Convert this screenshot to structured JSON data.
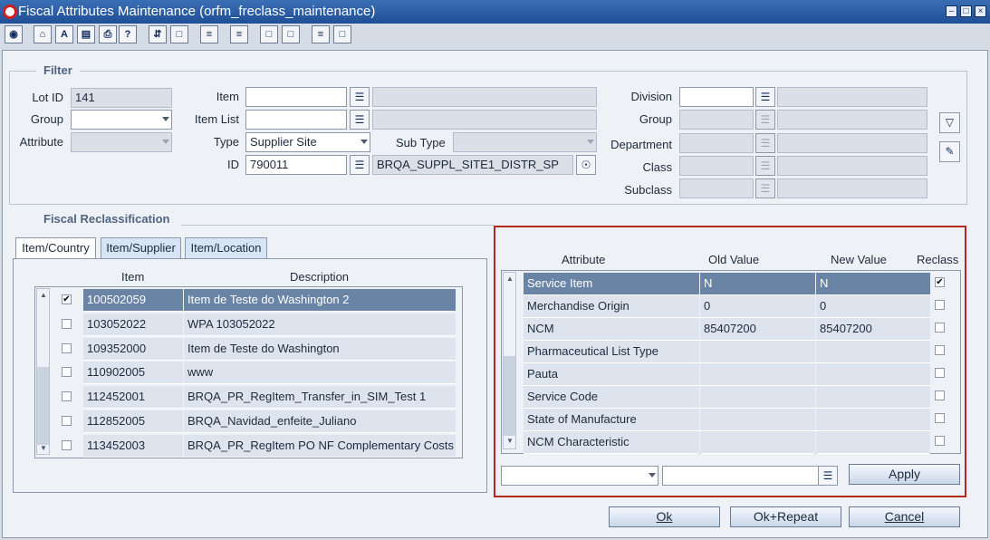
{
  "window": {
    "title": "Fiscal Attributes Maintenance  (orfm_freclass_maintenance)"
  },
  "toolbar": {
    "icons": [
      "globe-icon",
      "home-icon",
      "spellcheck-icon",
      "clipboard-icon",
      "print-icon",
      "help-icon",
      "relate-icon",
      "new-doc-icon",
      "list-icon",
      "list-alt-icon",
      "doc-icon",
      "doc-alt-icon",
      "nav-list-icon",
      "nav-doc-icon"
    ]
  },
  "filter": {
    "title": "Filter",
    "lot_id_label": "Lot ID",
    "lot_id_value": "141",
    "group_label": "Group",
    "group_value": "",
    "attribute_label": "Attribute",
    "attribute_value": "",
    "item_label": "Item",
    "item_value": "",
    "item_list_label": "Item List",
    "item_list_value": "",
    "type_label": "Type",
    "type_value": "Supplier Site",
    "sub_type_label": "Sub Type",
    "sub_type_value": "",
    "id_label": "ID",
    "id_value": "790011",
    "id_desc": "BRQA_SUPPL_SITE1_DISTR_SP",
    "division_label": "Division",
    "group2_label": "Group",
    "department_label": "Department",
    "class_label": "Class",
    "subclass_label": "Subclass"
  },
  "reclass": {
    "title": "Fiscal Reclassification",
    "tabs": [
      {
        "label": "Item/Country"
      },
      {
        "label": "Item/Supplier"
      },
      {
        "label": "Item/Location"
      }
    ],
    "items_header": {
      "item": "Item",
      "description": "Description"
    },
    "items": [
      {
        "checked": true,
        "item": "100502059",
        "description": "Item de Teste do Washington 2"
      },
      {
        "checked": false,
        "item": "103052022",
        "description": "WPA 103052022"
      },
      {
        "checked": false,
        "item": "109352000",
        "description": "Item de Teste do Washington"
      },
      {
        "checked": false,
        "item": "110902005",
        "description": "www"
      },
      {
        "checked": false,
        "item": "112452001",
        "description": "BRQA_PR_RegItem_Transfer_in_SIM_Test 1"
      },
      {
        "checked": false,
        "item": "112852005",
        "description": "BRQA_Navidad_enfeite_Juliano"
      },
      {
        "checked": false,
        "item": "113452003",
        "description": "BRQA_PR_RegItem PO NF Complementary Costs"
      }
    ],
    "attr_header": {
      "attribute": "Attribute",
      "old_value": "Old Value",
      "new_value": "New Value",
      "reclass": "Reclass"
    },
    "attributes": [
      {
        "attribute": "Service Item",
        "old_value": "N",
        "new_value": "N",
        "reclass": true
      },
      {
        "attribute": "Merchandise Origin",
        "old_value": "0",
        "new_value": "0",
        "reclass": false
      },
      {
        "attribute": "NCM",
        "old_value": "85407200",
        "new_value": "85407200",
        "reclass": false
      },
      {
        "attribute": "Pharmaceutical List Type",
        "old_value": "",
        "new_value": "",
        "reclass": false
      },
      {
        "attribute": "Pauta",
        "old_value": "",
        "new_value": "",
        "reclass": false
      },
      {
        "attribute": "Service Code",
        "old_value": "",
        "new_value": "",
        "reclass": false
      },
      {
        "attribute": "State of Manufacture",
        "old_value": "",
        "new_value": "",
        "reclass": false
      },
      {
        "attribute": "NCM Characteristic",
        "old_value": "",
        "new_value": "",
        "reclass": false
      }
    ],
    "apply_label": "Apply"
  },
  "footer": {
    "ok_label": "Ok",
    "ok_repeat_label": "Ok+Repeat",
    "cancel_label": "Cancel"
  },
  "colors": {
    "titlebar": "#1f4f96",
    "selected_row": "#6a84a6",
    "highlight_border": "#b22a1a"
  }
}
